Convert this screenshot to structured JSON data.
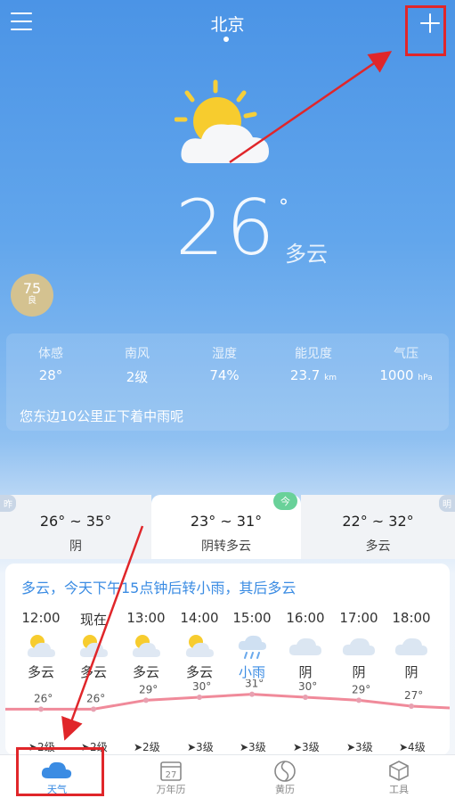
{
  "header": {
    "city": "北京"
  },
  "current": {
    "temp": "26",
    "degree": "°",
    "condition": "多云",
    "aqi": {
      "value": "75",
      "level": "良"
    }
  },
  "details": [
    {
      "label": "体感",
      "value": "28°",
      "unit": ""
    },
    {
      "label": "南风",
      "value": "2级",
      "unit": ""
    },
    {
      "label": "湿度",
      "value": "74%",
      "unit": ""
    },
    {
      "label": "能见度",
      "value": "23.7",
      "unit": "km"
    },
    {
      "label": "气压",
      "value": "1000",
      "unit": "hPa"
    }
  ],
  "note": "您东边10公里正下着中雨呢",
  "days": [
    {
      "flag": "昨",
      "temps": "26° ~ 35°",
      "cond": "阴"
    },
    {
      "flag": "今",
      "temps": "23° ~ 31°",
      "cond": "阴转多云"
    },
    {
      "flag": "明",
      "temps": "22° ~ 32°",
      "cond": "多云"
    }
  ],
  "summary": "多云，今天下午15点钟后转小雨，其后多云",
  "hourly": [
    {
      "time": "12:00",
      "icon": "partly-cloudy-icon",
      "cond": "多云",
      "temp": "26°",
      "wind": "2级"
    },
    {
      "time": "现在",
      "icon": "partly-cloudy-icon",
      "cond": "多云",
      "temp": "26°",
      "wind": "2级"
    },
    {
      "time": "13:00",
      "icon": "partly-cloudy-icon",
      "cond": "多云",
      "temp": "29°",
      "wind": "2级"
    },
    {
      "time": "14:00",
      "icon": "partly-cloudy-icon",
      "cond": "多云",
      "temp": "30°",
      "wind": "3级"
    },
    {
      "time": "15:00",
      "icon": "light-rain-icon",
      "cond": "小雨",
      "temp": "31°",
      "wind": "3级"
    },
    {
      "time": "16:00",
      "icon": "cloudy-icon",
      "cond": "阴",
      "temp": "30°",
      "wind": "3级"
    },
    {
      "time": "17:00",
      "icon": "cloudy-icon",
      "cond": "阴",
      "temp": "29°",
      "wind": "3级"
    },
    {
      "time": "18:00",
      "icon": "cloudy-icon",
      "cond": "阴",
      "temp": "27°",
      "wind": "4级"
    }
  ],
  "nav": [
    {
      "label": "天气",
      "icon": "cloud-icon",
      "active": true
    },
    {
      "label": "万年历",
      "icon": "calendar-icon",
      "date": "27"
    },
    {
      "label": "黄历",
      "icon": "almanac-icon"
    },
    {
      "label": "工具",
      "icon": "tools-icon"
    }
  ],
  "colors": {
    "accent": "#3b8ce3",
    "annotation_red": "#e0262a",
    "temp_line": "#f08a9a",
    "today_flag": "#69d199",
    "aqi_good": "#d4c290"
  }
}
